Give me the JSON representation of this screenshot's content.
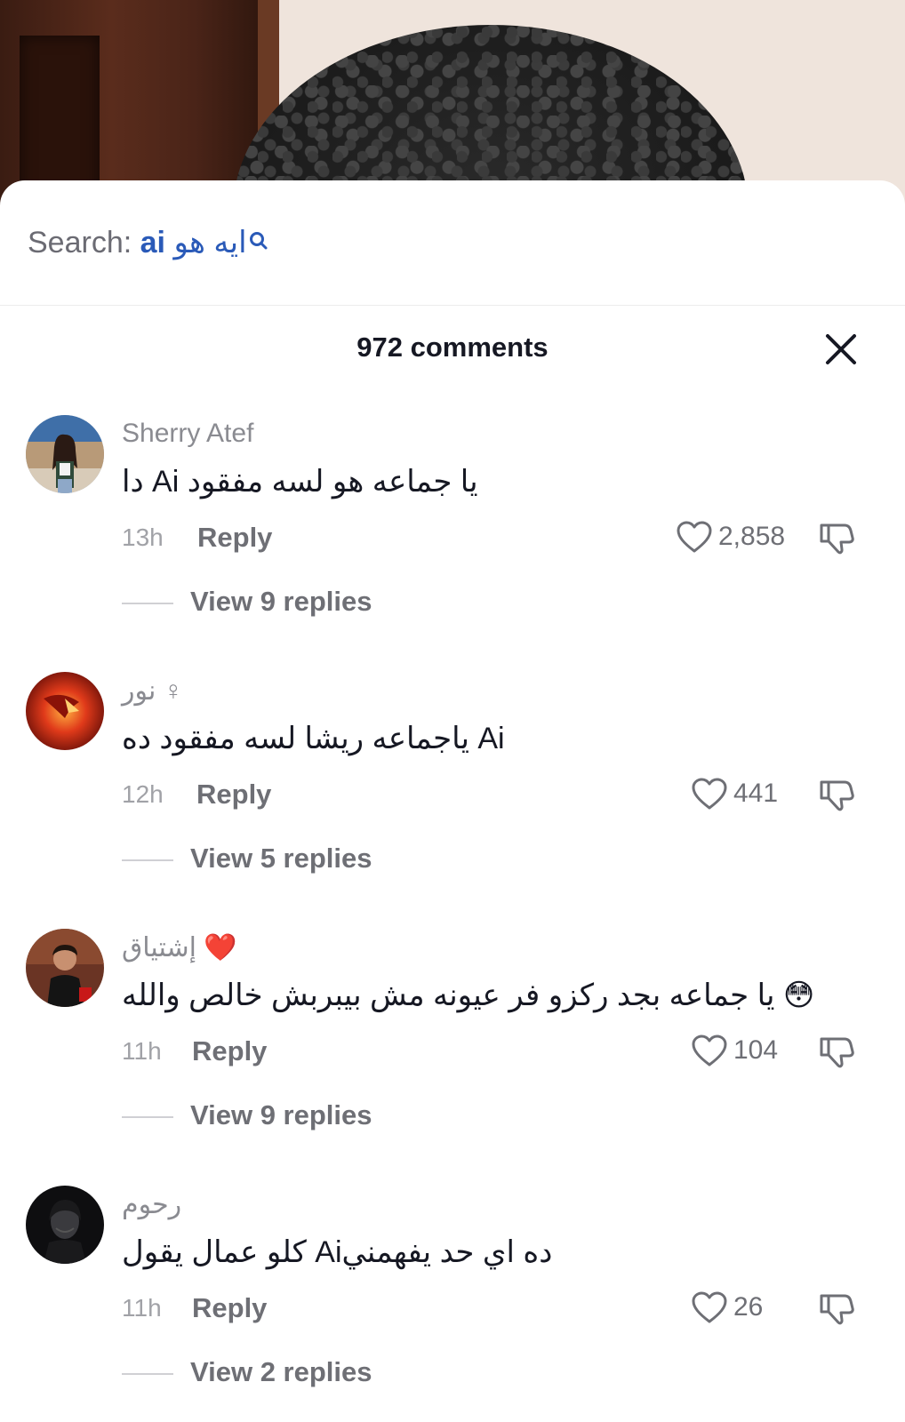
{
  "search": {
    "label": "Search: ",
    "query_latin": "ai",
    "query_arabic": "ايه هو"
  },
  "header": {
    "comment_count": "972 comments"
  },
  "comments": [
    {
      "username": "Sherry Atef",
      "text": "دا Ai يا جماعه هو لسه مفقود",
      "time": "13h",
      "reply_label": "Reply",
      "likes": "2,858",
      "view_replies": "View 9 replies"
    },
    {
      "username": "نور ♀",
      "text": "ياجماعه ريشا لسه مفقود ده Ai",
      "time": "12h",
      "reply_label": "Reply",
      "likes": "441",
      "view_replies": "View 5 replies"
    },
    {
      "username": "إشتياق ❤️",
      "text": "يا جماعه بجد ركزو فر عيونه مش بيبربش خالص والله 😳",
      "time": "11h",
      "reply_label": "Reply",
      "likes": "104",
      "view_replies": "View 9 replies"
    },
    {
      "username": "رحوم",
      "text": "كلو عمال يقول Aiده اي حد يفهمني",
      "time": "11h",
      "reply_label": "Reply",
      "likes": "26",
      "view_replies": "View 2 replies"
    }
  ],
  "colors": {
    "accent_blue": "#2a5ab8",
    "muted_text": "#8a8b91",
    "primary_text": "#161823"
  }
}
